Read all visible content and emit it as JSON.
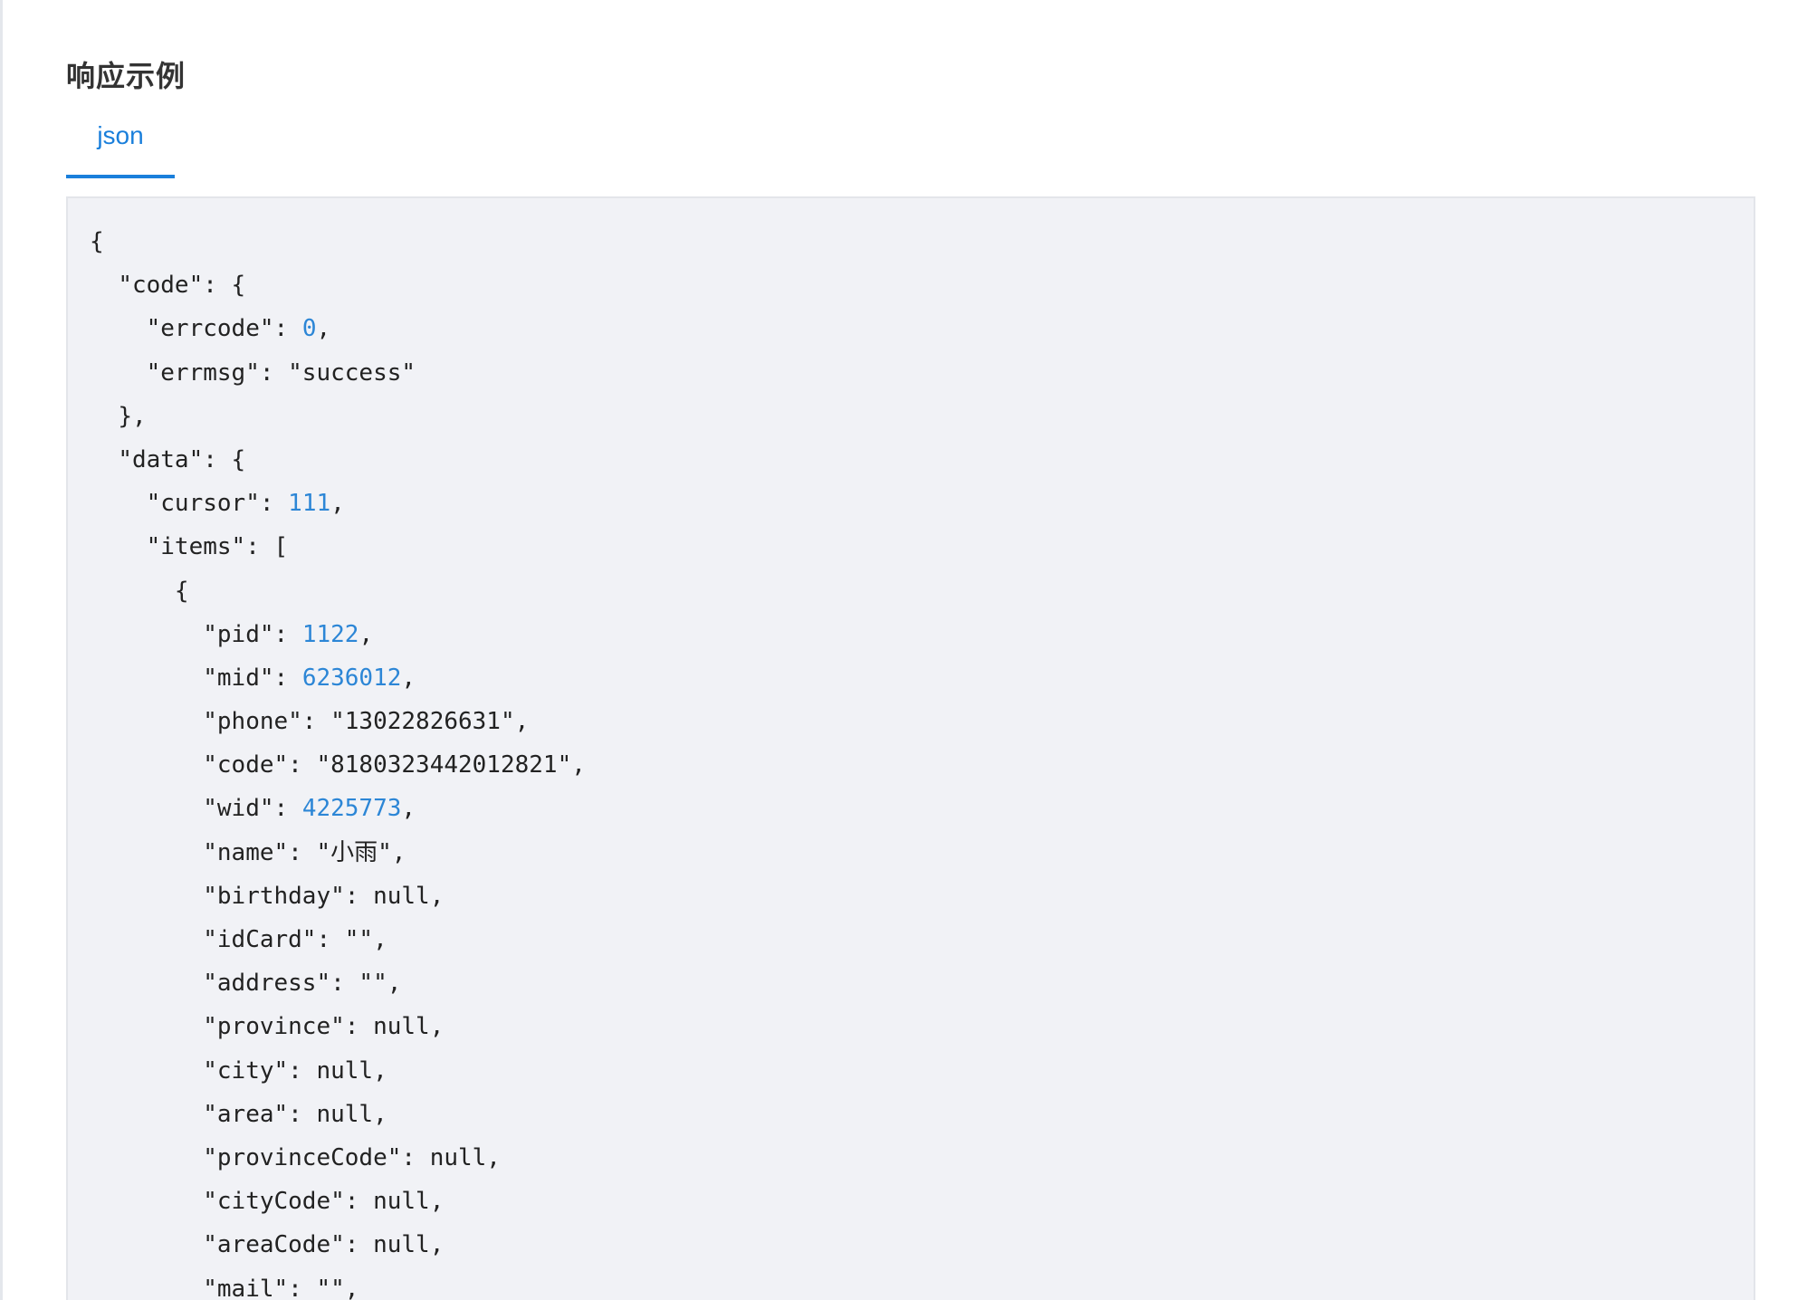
{
  "section": {
    "title": "响应示例"
  },
  "tabs": [
    {
      "label": "json",
      "active": true
    }
  ],
  "colors": {
    "accent": "#1a7fdb",
    "number": "#2c86d6",
    "code_background": "#f1f2f6",
    "text": "#222222"
  },
  "code": {
    "language": "json",
    "lines": [
      {
        "indent": "",
        "tokens": [
          {
            "t": "p",
            "v": "{"
          }
        ]
      },
      {
        "indent": "  ",
        "tokens": [
          {
            "t": "p",
            "v": "\"code\": {"
          }
        ]
      },
      {
        "indent": "    ",
        "tokens": [
          {
            "t": "p",
            "v": "\"errcode\": "
          },
          {
            "t": "n",
            "v": "0"
          },
          {
            "t": "p",
            "v": ","
          }
        ]
      },
      {
        "indent": "    ",
        "tokens": [
          {
            "t": "p",
            "v": "\"errmsg\": \"success\""
          }
        ]
      },
      {
        "indent": "  ",
        "tokens": [
          {
            "t": "p",
            "v": "},"
          }
        ]
      },
      {
        "indent": "  ",
        "tokens": [
          {
            "t": "p",
            "v": "\"data\": {"
          }
        ]
      },
      {
        "indent": "    ",
        "tokens": [
          {
            "t": "p",
            "v": "\"cursor\": "
          },
          {
            "t": "n",
            "v": "111"
          },
          {
            "t": "p",
            "v": ","
          }
        ]
      },
      {
        "indent": "    ",
        "tokens": [
          {
            "t": "p",
            "v": "\"items\": ["
          }
        ]
      },
      {
        "indent": "      ",
        "tokens": [
          {
            "t": "p",
            "v": "{"
          }
        ]
      },
      {
        "indent": "        ",
        "tokens": [
          {
            "t": "p",
            "v": "\"pid\": "
          },
          {
            "t": "n",
            "v": "1122"
          },
          {
            "t": "p",
            "v": ","
          }
        ]
      },
      {
        "indent": "        ",
        "tokens": [
          {
            "t": "p",
            "v": "\"mid\": "
          },
          {
            "t": "n",
            "v": "6236012"
          },
          {
            "t": "p",
            "v": ","
          }
        ]
      },
      {
        "indent": "        ",
        "tokens": [
          {
            "t": "p",
            "v": "\"phone\": \"13022826631\","
          }
        ]
      },
      {
        "indent": "        ",
        "tokens": [
          {
            "t": "p",
            "v": "\"code\": \"8180323442012821\","
          }
        ]
      },
      {
        "indent": "        ",
        "tokens": [
          {
            "t": "p",
            "v": "\"wid\": "
          },
          {
            "t": "n",
            "v": "4225773"
          },
          {
            "t": "p",
            "v": ","
          }
        ]
      },
      {
        "indent": "        ",
        "tokens": [
          {
            "t": "p",
            "v": "\"name\": \"小雨\","
          }
        ]
      },
      {
        "indent": "        ",
        "tokens": [
          {
            "t": "p",
            "v": "\"birthday\": null,"
          }
        ]
      },
      {
        "indent": "        ",
        "tokens": [
          {
            "t": "p",
            "v": "\"idCard\": \"\","
          }
        ]
      },
      {
        "indent": "        ",
        "tokens": [
          {
            "t": "p",
            "v": "\"address\": \"\","
          }
        ]
      },
      {
        "indent": "        ",
        "tokens": [
          {
            "t": "p",
            "v": "\"province\": null,"
          }
        ]
      },
      {
        "indent": "        ",
        "tokens": [
          {
            "t": "p",
            "v": "\"city\": null,"
          }
        ]
      },
      {
        "indent": "        ",
        "tokens": [
          {
            "t": "p",
            "v": "\"area\": null,"
          }
        ]
      },
      {
        "indent": "        ",
        "tokens": [
          {
            "t": "p",
            "v": "\"provinceCode\": null,"
          }
        ]
      },
      {
        "indent": "        ",
        "tokens": [
          {
            "t": "p",
            "v": "\"cityCode\": null,"
          }
        ]
      },
      {
        "indent": "        ",
        "tokens": [
          {
            "t": "p",
            "v": "\"areaCode\": null,"
          }
        ]
      },
      {
        "indent": "        ",
        "tokens": [
          {
            "t": "p",
            "v": "\"mail\": \"\","
          }
        ]
      }
    ]
  }
}
